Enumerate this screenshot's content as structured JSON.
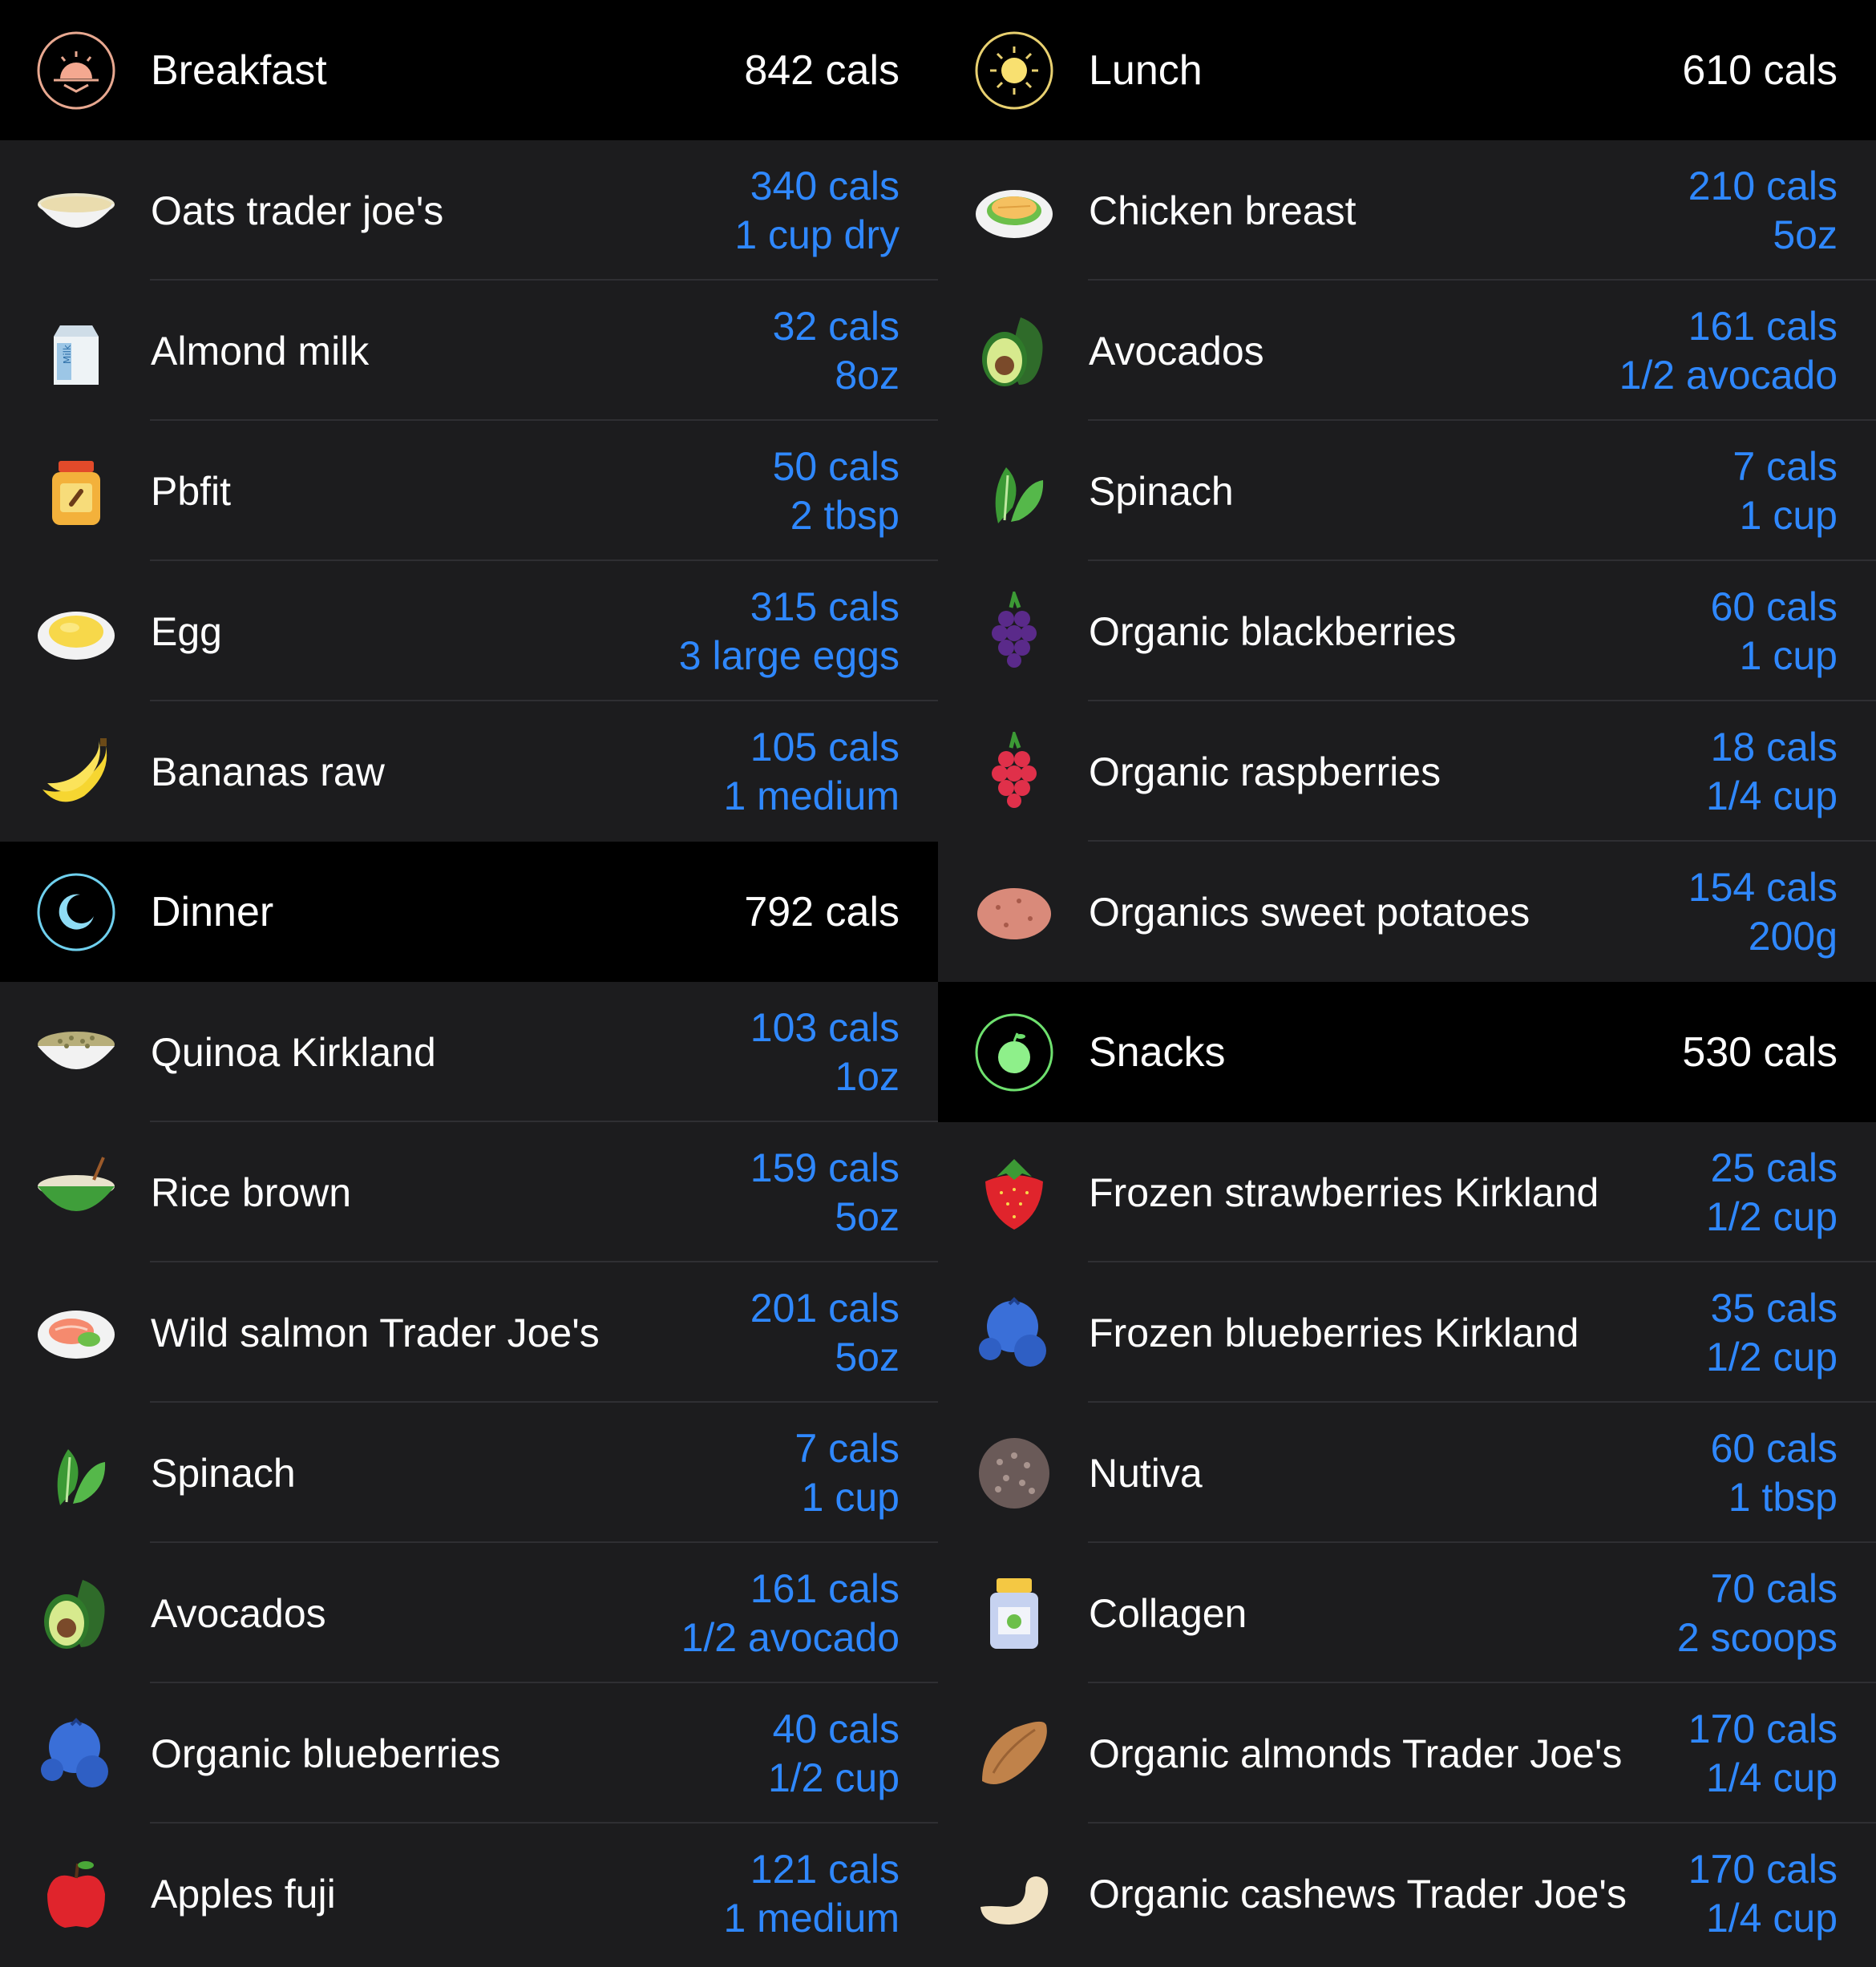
{
  "left": [
    {
      "title": "Breakfast",
      "total": "842 cals",
      "icon": "sunrise-icon",
      "items": [
        {
          "name": "Oats trader joe's",
          "cals": "340 cals",
          "portion": "1 cup dry",
          "icon": "oatmeal-bowl-icon"
        },
        {
          "name": "Almond milk",
          "cals": "32 cals",
          "portion": "8oz",
          "icon": "milk-carton-icon"
        },
        {
          "name": "Pbfit",
          "cals": "50 cals",
          "portion": "2 tbsp",
          "icon": "peanut-butter-jar-icon"
        },
        {
          "name": "Egg",
          "cals": "315 cals",
          "portion": "3 large eggs",
          "icon": "scrambled-egg-icon"
        },
        {
          "name": "Bananas raw",
          "cals": "105 cals",
          "portion": "1 medium",
          "icon": "banana-icon"
        }
      ]
    },
    {
      "title": "Dinner",
      "total": "792 cals",
      "icon": "moon-icon",
      "items": [
        {
          "name": "Quinoa Kirkland",
          "cals": "103 cals",
          "portion": "1oz",
          "icon": "quinoa-bowl-icon"
        },
        {
          "name": "Rice brown",
          "cals": "159 cals",
          "portion": "5oz",
          "icon": "rice-bowl-icon"
        },
        {
          "name": "Wild salmon Trader Joe's",
          "cals": "201 cals",
          "portion": "5oz",
          "icon": "salmon-plate-icon"
        },
        {
          "name": "Spinach",
          "cals": "7 cals",
          "portion": "1 cup",
          "icon": "spinach-icon"
        },
        {
          "name": "Avocados",
          "cals": "161 cals",
          "portion": "1/2 avocado",
          "icon": "avocado-icon"
        },
        {
          "name": "Organic blueberries",
          "cals": "40 cals",
          "portion": "1/2 cup",
          "icon": "blueberries-icon"
        },
        {
          "name": "Apples fuji",
          "cals": "121 cals",
          "portion": "1 medium",
          "icon": "apple-icon"
        }
      ]
    }
  ],
  "right": [
    {
      "title": "Lunch",
      "total": "610 cals",
      "icon": "sun-icon",
      "items": [
        {
          "name": "Chicken breast",
          "cals": "210 cals",
          "portion": "5oz",
          "icon": "chicken-plate-icon"
        },
        {
          "name": "Avocados",
          "cals": "161 cals",
          "portion": "1/2 avocado",
          "icon": "avocado-icon"
        },
        {
          "name": "Spinach",
          "cals": "7 cals",
          "portion": "1 cup",
          "icon": "spinach-icon"
        },
        {
          "name": "Organic blackberries",
          "cals": "60 cals",
          "portion": "1 cup",
          "icon": "blackberry-icon"
        },
        {
          "name": "Organic raspberries",
          "cals": "18 cals",
          "portion": "1/4 cup",
          "icon": "raspberry-icon"
        },
        {
          "name": "Organics sweet potatoes",
          "cals": "154 cals",
          "portion": "200g",
          "icon": "sweet-potato-icon"
        }
      ]
    },
    {
      "title": "Snacks",
      "total": "530 cals",
      "icon": "apple-outline-icon",
      "items": [
        {
          "name": "Frozen strawberries Kirkland",
          "cals": "25 cals",
          "portion": "1/2 cup",
          "icon": "strawberry-icon"
        },
        {
          "name": "Frozen blueberries Kirkland",
          "cals": "35 cals",
          "portion": "1/2 cup",
          "icon": "blueberries-icon"
        },
        {
          "name": "Nutiva",
          "cals": "60 cals",
          "portion": "1 tbsp",
          "icon": "seeds-icon"
        },
        {
          "name": "Collagen",
          "cals": "70 cals",
          "portion": "2 scoops",
          "icon": "supplement-jar-icon"
        },
        {
          "name": "Organic almonds Trader Joe's",
          "cals": "170 cals",
          "portion": "1/4 cup",
          "icon": "almond-icon"
        },
        {
          "name": "Organic cashews Trader Joe's",
          "cals": "170 cals",
          "portion": "1/4 cup",
          "icon": "cashew-icon"
        }
      ]
    }
  ],
  "colors": {
    "background": "#1c1c1e",
    "header": "#000000",
    "accent": "#2f88ff",
    "text": "#ffffff"
  }
}
